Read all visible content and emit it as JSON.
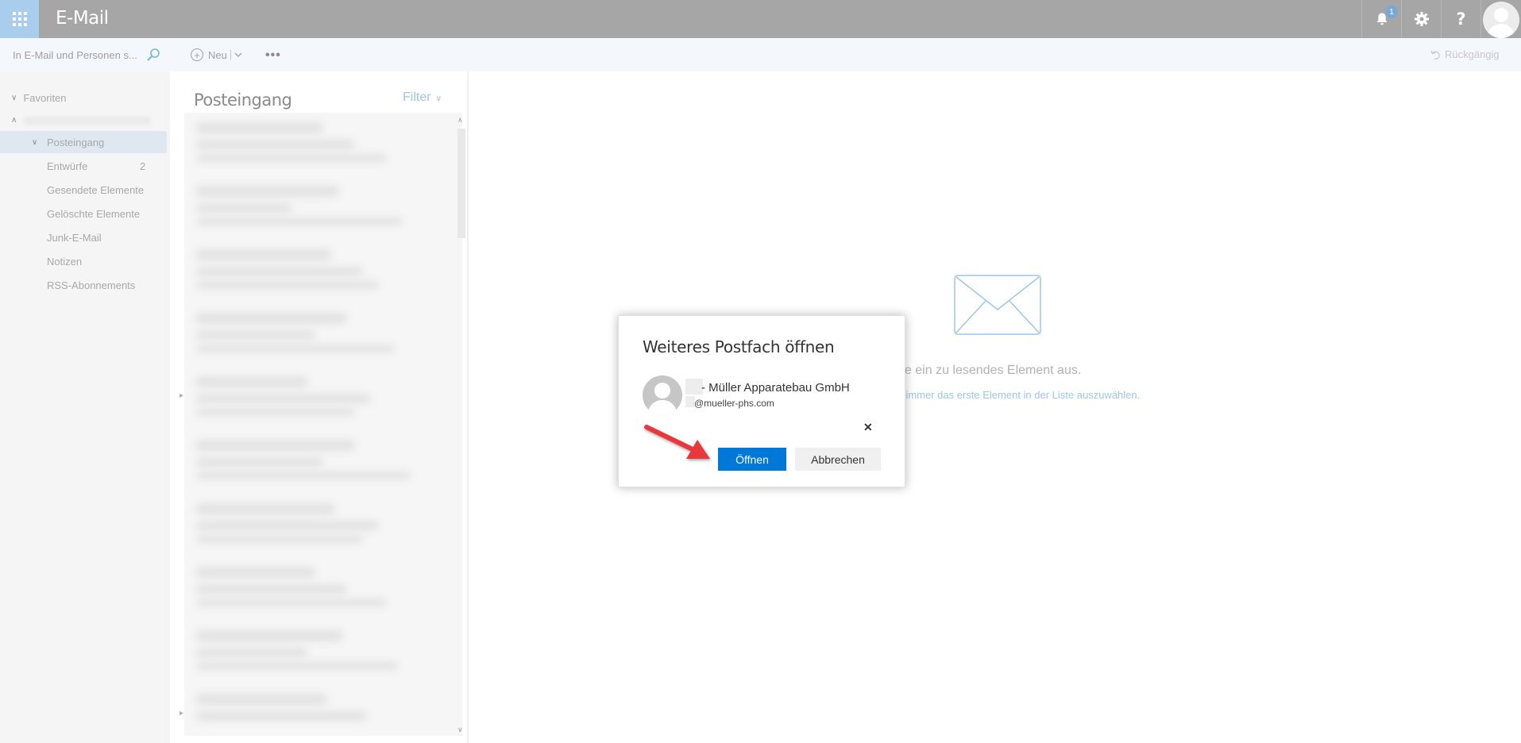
{
  "app": {
    "title": "E-Mail",
    "notification_count": "1"
  },
  "colors": {
    "topbar": "#a6a6a6",
    "waffle": "#a9cdec",
    "primary_button": "#0078d7",
    "annotation_arrow": "#e8393a"
  },
  "icons": [
    "app-launcher-icon",
    "bell-icon",
    "gear-icon",
    "help-icon",
    "user-avatar-icon",
    "search-icon",
    "plus-circle-icon",
    "chevron-down-icon",
    "more-icon",
    "undo-icon",
    "envelope-icon",
    "close-icon"
  ],
  "search": {
    "placeholder": "In E-Mail und Personen s..."
  },
  "commands": {
    "new_label": "Neu",
    "more_label": "•••",
    "undo_label": "Rückgängig"
  },
  "folders": {
    "favorites_label": "Favoriten",
    "inbox_label": "Posteingang",
    "items": [
      {
        "label": "Entwürfe",
        "count": "2"
      },
      {
        "label": "Gesendete Elemente",
        "count": ""
      },
      {
        "label": "Gelöschte Elemente",
        "count": ""
      },
      {
        "label": "Junk-E-Mail",
        "count": ""
      },
      {
        "label": "Notizen",
        "count": ""
      },
      {
        "label": "RSS-Abonnements",
        "count": ""
      }
    ]
  },
  "message_list": {
    "title": "Posteingang",
    "filter_label": "Filter"
  },
  "reading_pane": {
    "empty_message": "hlen Sie ein zu lesendes Element aus.",
    "empty_link": "m immer das erste Element in der Liste auszuwählen."
  },
  "dialog": {
    "title": "Weiteres Postfach öffnen",
    "mailbox_name": "- Müller Apparatebau GmbH",
    "mailbox_email": "@mueller-phs.com",
    "open_label": "Öffnen",
    "cancel_label": "Abbrechen",
    "close_label": "✕"
  }
}
